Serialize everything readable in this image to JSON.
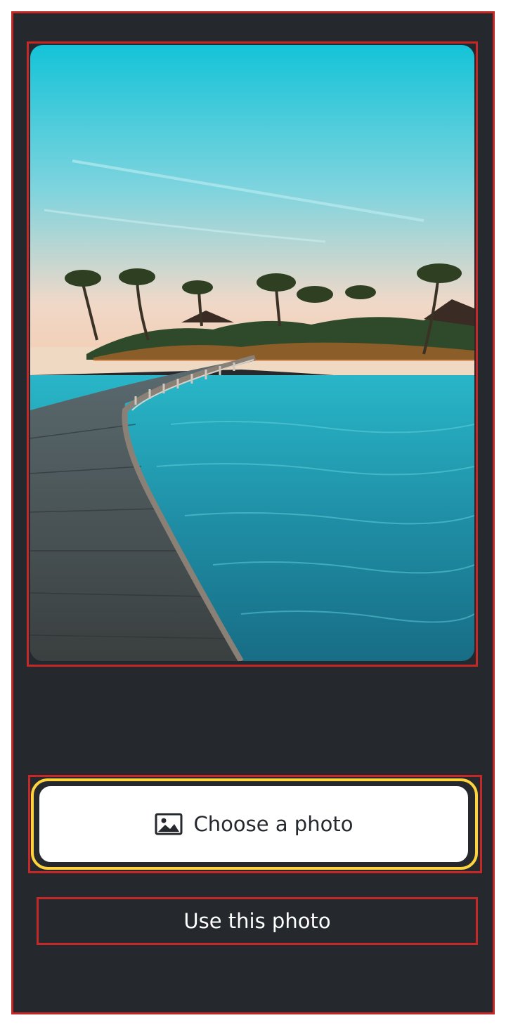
{
  "screen": {
    "background_color": "#25292e",
    "annotation_border_color": "#c62828",
    "focus_highlight_color": "#ffd33d"
  },
  "photo": {
    "description_icon": "beach-boardwalk-image",
    "corner_style": "rounded"
  },
  "actions": {
    "choose_label": "Choose a photo",
    "choose_icon": "image-icon",
    "use_label": "Use this photo"
  }
}
